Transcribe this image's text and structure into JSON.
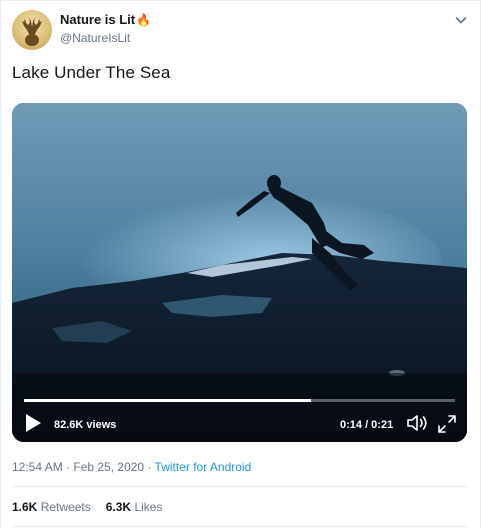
{
  "author": {
    "display_name": "Nature is Lit",
    "emoji": "🔥",
    "handle": "@NatureIsLit",
    "avatar_icon": "deer-avatar-icon"
  },
  "tweet": {
    "text": "Lake Under The Sea"
  },
  "video": {
    "views": "82.6K views",
    "time": "0:14 / 0:21",
    "progress": 0.667
  },
  "meta": {
    "timestamp": "12:54 AM · Feb 25, 2020",
    "separator": " · ",
    "source": "Twitter for Android"
  },
  "stats": {
    "retweets_count": "1.6K",
    "retweets_label": "Retweets",
    "likes_count": "6.3K",
    "likes_label": "Likes"
  },
  "colors": {
    "link": "#1b95e0",
    "muted": "#657786",
    "text": "#14171a"
  }
}
